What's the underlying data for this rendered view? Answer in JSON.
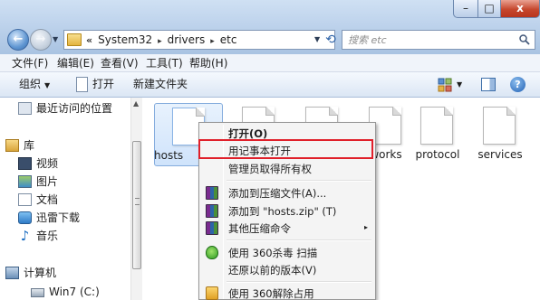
{
  "window": {
    "controls": {
      "minimize": "–",
      "maximize": "□",
      "close": "x"
    }
  },
  "address": {
    "lead_chevrons": "«",
    "crumbs": [
      "System32",
      "drivers",
      "etc"
    ],
    "separator": "▸"
  },
  "search": {
    "placeholder": "搜索 etc"
  },
  "menubar": {
    "items": [
      "文件(F)",
      "编辑(E)",
      "查看(V)",
      "工具(T)",
      "帮助(H)"
    ]
  },
  "toolbar": {
    "organize": "组织",
    "open": "打开",
    "new_folder": "新建文件夹",
    "help": "?"
  },
  "navpane": {
    "items": [
      {
        "label": "最近访问的位置",
        "icon": "recent-places-icon"
      },
      {
        "label": "库",
        "icon": "library-icon"
      },
      {
        "label": "视频",
        "icon": "video-icon"
      },
      {
        "label": "图片",
        "icon": "pictures-icon"
      },
      {
        "label": "文档",
        "icon": "documents-icon"
      },
      {
        "label": "迅雷下载",
        "icon": "xunlei-icon"
      },
      {
        "label": "音乐",
        "icon": "music-icon"
      },
      {
        "label": "计算机",
        "icon": "computer-icon"
      },
      {
        "label": "Win7 (C:)",
        "icon": "drive-icon"
      }
    ]
  },
  "files": [
    {
      "name": "hosts",
      "selected": true
    },
    {
      "name": ""
    },
    {
      "name": ""
    },
    {
      "name": "works"
    },
    {
      "name": "protocol"
    },
    {
      "name": "services"
    }
  ],
  "context_menu": {
    "items": [
      {
        "label": "打开(O)",
        "bold": true
      },
      {
        "label": "用记事本打开",
        "highlighted": true
      },
      {
        "label": "管理员取得所有权"
      },
      {
        "label": "添加到压缩文件(A)...",
        "icon": "winrar-icon"
      },
      {
        "label": "添加到 \"hosts.zip\" (T)",
        "icon": "winrar-icon"
      },
      {
        "label": "其他压缩命令",
        "icon": "winrar-icon",
        "submenu": "▸"
      },
      {
        "label": "使用 360杀毒 扫描",
        "icon": "shield-360-icon"
      },
      {
        "label": "还原以前的版本(V)"
      },
      {
        "label": "使用 360解除占用",
        "icon": "unlock-360-icon"
      }
    ]
  },
  "colors": {
    "highlight_border": "#e0202a",
    "titlebar": "#bed3ec",
    "close_button": "#c6472d"
  }
}
